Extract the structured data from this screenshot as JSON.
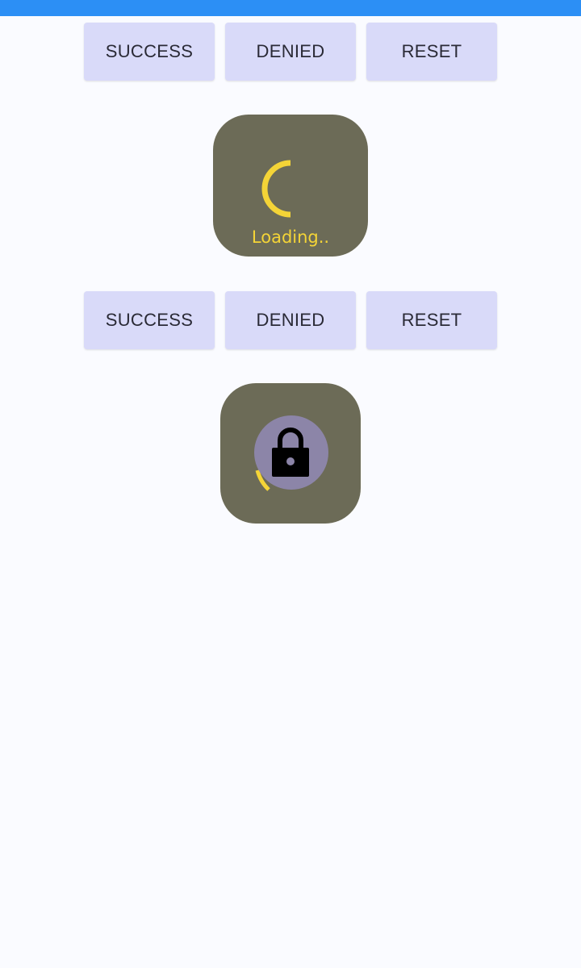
{
  "colors": {
    "status_bar": "#2c8ff5",
    "background": "#fafbff",
    "button_bg": "#d9daf9",
    "card_bg": "#6c6b57",
    "accent_yellow": "#f4d437",
    "lock_circle": "#8c85a8"
  },
  "button_rows": [
    {
      "success_label": "SUCCESS",
      "denied_label": "DENIED",
      "reset_label": "RESET"
    },
    {
      "success_label": "SUCCESS",
      "denied_label": "DENIED",
      "reset_label": "RESET"
    }
  ],
  "loading_card": {
    "text": "Loading..",
    "icon": "spinner-icon"
  },
  "lock_card": {
    "icon": "lock-icon",
    "progress_icon": "spinner-arc-icon"
  }
}
